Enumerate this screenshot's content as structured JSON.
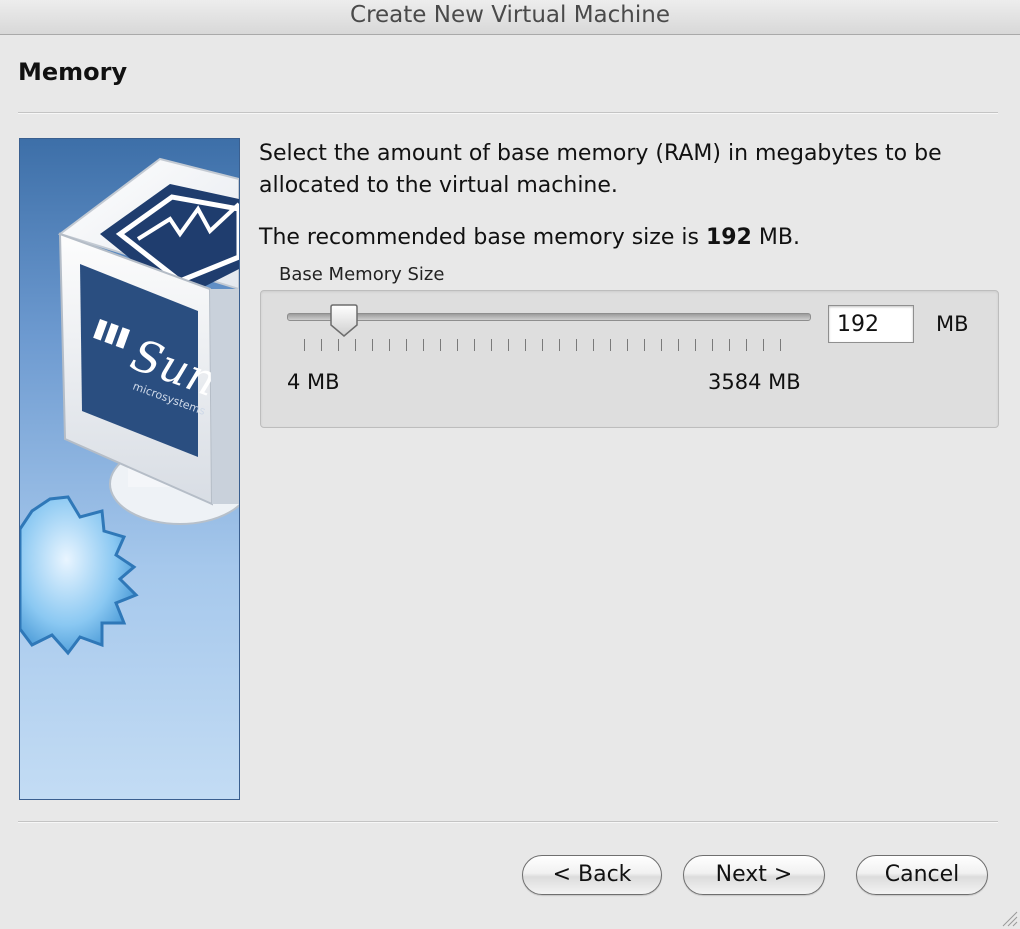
{
  "window": {
    "title": "Create New Virtual Machine"
  },
  "page": {
    "title": "Memory"
  },
  "description": "Select the amount of base memory (RAM) in megabytes to be allocated to the virtual machine.",
  "recommendation": {
    "prefix": "The recommended base memory size is ",
    "value": "192",
    "suffix": " MB."
  },
  "memory": {
    "group_label": "Base Memory Size",
    "min_label": "4 MB",
    "max_label": "3584 MB",
    "value": "192",
    "unit": "MB",
    "min": 4,
    "max": 3584
  },
  "side_image": {
    "logo_text": "Sun",
    "logo_subtext": "microsystems"
  },
  "buttons": {
    "back": "< Back",
    "next": "Next >",
    "cancel": "Cancel"
  },
  "colors": {
    "panel_blue": "#3d6fa8",
    "background": "#e8e8e8"
  }
}
